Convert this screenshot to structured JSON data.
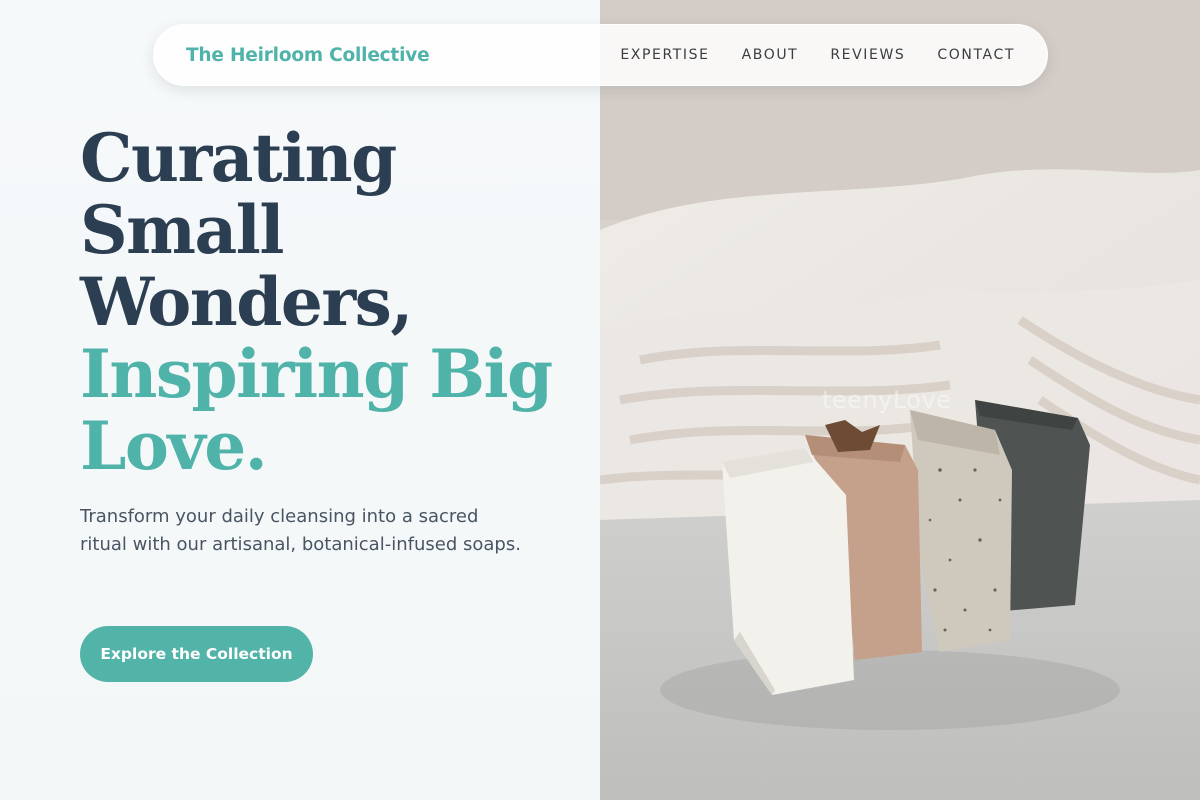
{
  "nav": {
    "brand": "The Heirloom Collective",
    "links": [
      "EXPERTISE",
      "ABOUT",
      "REVIEWS",
      "CONTACT"
    ]
  },
  "hero": {
    "headline_lines": [
      {
        "text": "Curating",
        "tone": "dark"
      },
      {
        "text": "Small",
        "tone": "dark"
      },
      {
        "text": "Wonders,",
        "tone": "dark"
      },
      {
        "text": "Inspiring Big",
        "tone": "accent"
      },
      {
        "text": "Love.",
        "tone": "accent"
      }
    ],
    "subtext": "Transform your daily cleansing into a sacred ritual with our artisanal, botanical-infused soaps.",
    "cta_label": "Explore the Collection"
  },
  "image": {
    "watermark": "teenyLove"
  },
  "colors": {
    "accent": "#4fb3a9",
    "dark": "#2c3e52",
    "background": "#f4f8f9"
  }
}
